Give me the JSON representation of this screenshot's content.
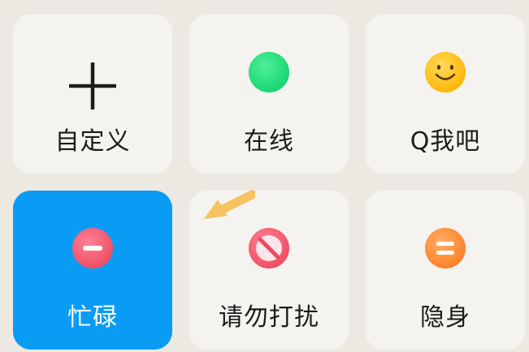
{
  "status_panel": {
    "tiles": [
      {
        "label": "自定义",
        "icon": "plus-icon",
        "selected": false
      },
      {
        "label": "在线",
        "icon": "online-dot-icon",
        "selected": false
      },
      {
        "label": "Q我吧",
        "icon": "smiley-face-icon",
        "selected": false
      },
      {
        "label": "忙碌",
        "icon": "busy-minus-icon",
        "selected": true
      },
      {
        "label": "请勿打扰",
        "icon": "do-not-disturb-icon",
        "selected": false
      },
      {
        "label": "隐身",
        "icon": "invisible-equals-icon",
        "selected": false
      }
    ]
  },
  "colors": {
    "background": "#ece9e2",
    "tile": "#f5f3ef",
    "selected_tile": "#0a9cf5",
    "online_green": "#1fdc7a",
    "smiley_yellow": "#ffc61f",
    "busy_red": "#f25d72",
    "dnd_red": "#f25d72",
    "invisible_orange": "#ff8f3a",
    "hint_arrow": "#f6c260"
  }
}
